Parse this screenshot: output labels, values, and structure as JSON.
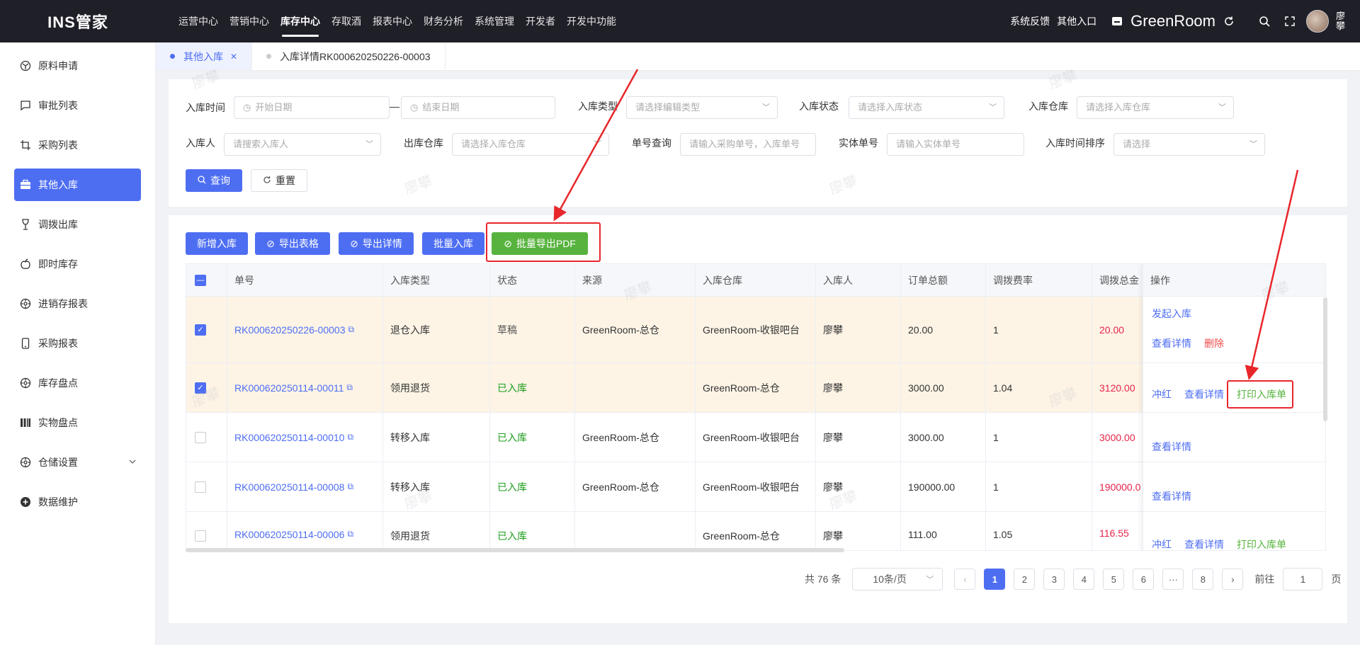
{
  "app": {
    "logo": "INS管家",
    "top_nav": [
      "运营中心",
      "营销中心",
      "库存中心",
      "存取酒",
      "报表中心",
      "财务分析",
      "系统管理",
      "开发者",
      "开发中功能"
    ],
    "active_nav": "库存中心",
    "top_right": {
      "feedback": "系统反馈",
      "other_entry": "其他入口",
      "brand": "GreenRoom",
      "user": "廖攀"
    }
  },
  "sidebar": {
    "items": [
      {
        "label": "原料申请",
        "icon": "dashboard-icon"
      },
      {
        "label": "审批列表",
        "icon": "message-icon"
      },
      {
        "label": "采购列表",
        "icon": "crop-icon"
      },
      {
        "label": "其他入库",
        "icon": "briefcase-icon",
        "active": true
      },
      {
        "label": "调拨出库",
        "icon": "wine-glass-icon"
      },
      {
        "label": "即时库存",
        "icon": "apple-icon"
      },
      {
        "label": "进销存报表",
        "icon": "settings-icon"
      },
      {
        "label": "采购报表",
        "icon": "phone-icon"
      },
      {
        "label": "库存盘点",
        "icon": "settings-icon"
      },
      {
        "label": "实物盘点",
        "icon": "bars-icon"
      },
      {
        "label": "仓储设置",
        "icon": "settings-icon",
        "expandable": true
      },
      {
        "label": "数据维护",
        "icon": "plus-circle-icon"
      }
    ]
  },
  "tabs": [
    {
      "label": "其他入库",
      "active": true,
      "closable": true
    },
    {
      "label": "入库详情RK000620250226-00003",
      "active": false
    }
  ],
  "filters": {
    "in_time_label": "入库时间",
    "start_date": "开始日期",
    "end_date": "结束日期",
    "in_type_label": "入库类型",
    "in_type_ph": "请选择编辑类型",
    "in_status_label": "入库状态",
    "in_status_ph": "请选择入库状态",
    "in_wh_label": "入库仓库",
    "in_wh_ph": "请选择入库仓库",
    "person_label": "入库人",
    "person_ph": "请搜索入库人",
    "out_wh_label": "出库仓库",
    "out_wh_ph": "请选择入库仓库",
    "order_label": "单号查询",
    "order_ph": "请输入采购单号，入库单号",
    "entity_label": "实体单号",
    "entity_ph": "请输入实体单号",
    "sort_label": "入库时间排序",
    "sort_ph": "请选择",
    "search_btn": "查询",
    "reset_btn": "重置"
  },
  "toolbar": {
    "add": "新增入库",
    "export_table": "导出表格",
    "export_detail": "导出详情",
    "batch_in": "批量入库",
    "batch_pdf": "批量导出PDF"
  },
  "table": {
    "headers": [
      "单号",
      "入库类型",
      "状态",
      "来源",
      "入库仓库",
      "入库人",
      "订单总额",
      "调拨费率",
      "调拨总金",
      "操作"
    ],
    "rows": [
      {
        "no": "RK000620250226-00003",
        "type": "退仓入库",
        "status": "草稿",
        "source": "GreenRoom-总仓",
        "wh": "GreenRoom-收银吧台",
        "person": "廖攀",
        "amount": "20.00",
        "rate": "1",
        "total": "20.00",
        "checked": true,
        "ops": [
          "发起入库",
          "查看详情",
          "删除"
        ]
      },
      {
        "no": "RK000620250114-00011",
        "type": "领用退货",
        "status": "已入库",
        "source": "",
        "wh": "GreenRoom-总仓",
        "person": "廖攀",
        "amount": "3000.00",
        "rate": "1.04",
        "total": "3120.00",
        "checked": true,
        "ops": [
          "冲红",
          "查看详情",
          "打印入库单"
        ]
      },
      {
        "no": "RK000620250114-00010",
        "type": "转移入库",
        "status": "已入库",
        "source": "GreenRoom-总仓",
        "wh": "GreenRoom-收银吧台",
        "person": "廖攀",
        "amount": "3000.00",
        "rate": "1",
        "total": "3000.00",
        "checked": false,
        "ops": [
          "查看详情"
        ]
      },
      {
        "no": "RK000620250114-00008",
        "type": "转移入库",
        "status": "已入库",
        "source": "GreenRoom-总仓",
        "wh": "GreenRoom-收银吧台",
        "person": "廖攀",
        "amount": "190000.00",
        "rate": "1",
        "total": "190000.0",
        "checked": false,
        "ops": [
          "查看详情"
        ]
      },
      {
        "no": "RK000620250114-00006",
        "type": "领用退货",
        "status": "已入库",
        "source": "",
        "wh": "GreenRoom-总仓",
        "person": "廖攀",
        "amount": "111.00",
        "rate": "1.05",
        "total": "116.55",
        "checked": false,
        "ops": [
          "冲红",
          "查看详情",
          "打印入库单"
        ]
      }
    ]
  },
  "pagination": {
    "total": "共 76 条",
    "page_size": "10条/页",
    "pages": [
      "1",
      "2",
      "3",
      "4",
      "5",
      "6",
      "···",
      "8"
    ],
    "current": "1",
    "goto_label": "前往",
    "goto_value": "1",
    "page_suffix": "页"
  },
  "watermark": "廖攀",
  "colors": {
    "primary": "#4e6ef2",
    "topbar": "#1f1f28",
    "green": "#57b33e",
    "annotation": "#e8262a"
  }
}
